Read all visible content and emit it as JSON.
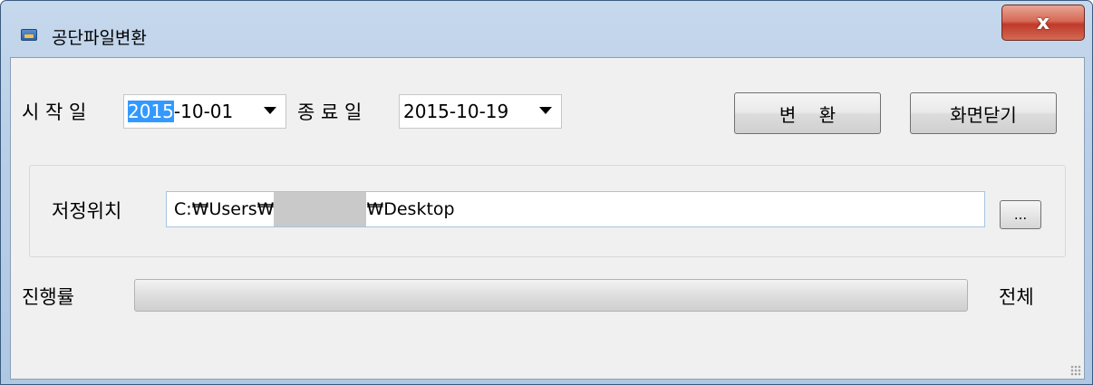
{
  "window": {
    "title": "공단파일변환",
    "close_glyph": "x",
    "app_icon": "app-window-icon",
    "colors": {
      "close": "#c0392b",
      "frame": "#b9cfe7",
      "client": "#f0f0f0",
      "selection": "#3399ff"
    }
  },
  "dates": {
    "start_label": "시 작 일",
    "start_value_selected": "2015",
    "start_value_rest": "-10-01",
    "end_label": "종 료 일",
    "end_value": "2015-10-19",
    "dropdown_icon": "chevron-down-icon"
  },
  "buttons": {
    "convert": "변    환",
    "close_screen": "화면닫기",
    "browse": "..."
  },
  "save": {
    "label": "저정위치",
    "path_prefix": "C:₩Users₩",
    "path_suffix": "₩Desktop"
  },
  "progress": {
    "label": "진행률",
    "total_label": "전체",
    "value": 0
  }
}
